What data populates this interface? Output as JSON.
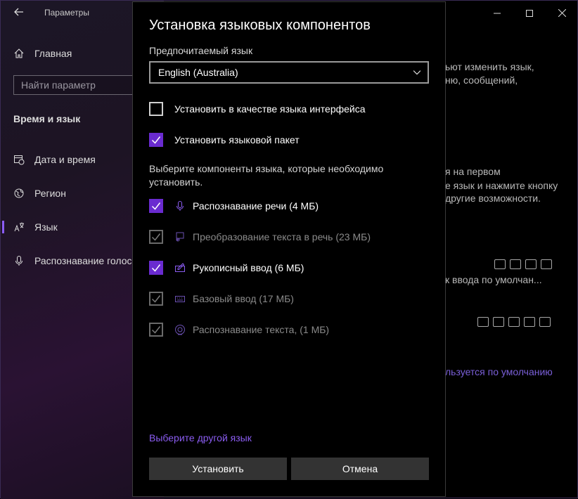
{
  "window": {
    "title": "Параметры",
    "back_icon": "arrow-left-icon",
    "controls": [
      "minimize-icon",
      "maximize-icon",
      "close-icon"
    ]
  },
  "sidebar": {
    "home_label": "Главная",
    "search_placeholder": "Найти параметр",
    "section_title": "Время и язык",
    "items": [
      {
        "label": "Дата и время",
        "icon": "calendar-clock-icon"
      },
      {
        "label": "Регион",
        "icon": "globe-icon"
      },
      {
        "label": "Язык",
        "icon": "language-icon",
        "active": true
      },
      {
        "label": "Распознавание голоса",
        "icon": "microphone-icon"
      }
    ]
  },
  "background": {
    "line1": "ьют изменить язык,",
    "line2": "ню, сообщений,",
    "line3": "я на первом",
    "line4": "е язык и нажмите кнопку",
    "line5": "другие возможности.",
    "lang1_sub": "к ввода по умолчан...",
    "link": "льзуется по умолчанию"
  },
  "dialog": {
    "title": "Установка языковых компонентов",
    "preferred_label": "Предпочитаемый язык",
    "preferred_value": "English (Australia)",
    "set_display_label": "Установить в качестве языка интерфейса",
    "set_display_checked": false,
    "install_pack_label": "Установить языковой пакет",
    "install_pack_checked": true,
    "components_desc": "Выберите компоненты языка, которые необходимо установить.",
    "components": [
      {
        "label": "Распознавание речи (4 МБ)",
        "icon": "microphone-icon",
        "checked": true,
        "enabled": true
      },
      {
        "label": "Преобразование текста в речь (23 МБ)",
        "icon": "text-to-speech-icon",
        "checked": true,
        "enabled": false
      },
      {
        "label": "Рукописный ввод (6 МБ)",
        "icon": "handwriting-icon",
        "checked": true,
        "enabled": true
      },
      {
        "label": "Базовый ввод (17 МБ)",
        "icon": "keyboard-icon",
        "checked": true,
        "enabled": false
      },
      {
        "label": "Распознавание текста, (1 МБ)",
        "icon": "ocr-icon",
        "checked": true,
        "enabled": false
      }
    ],
    "other_language_link": "Выберите другой язык",
    "install_button": "Установить",
    "cancel_button": "Отмена"
  },
  "colors": {
    "accent": "#6a2bd0",
    "link": "#8a5cf0",
    "button_bg": "#333333"
  }
}
